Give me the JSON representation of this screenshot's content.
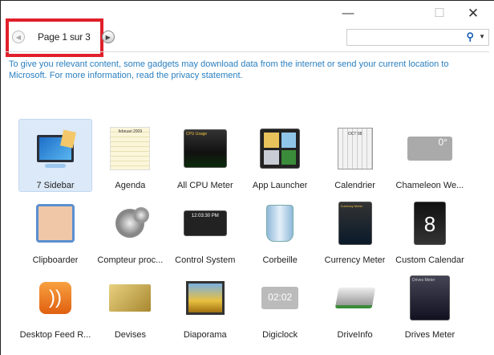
{
  "window": {
    "minimize": "—",
    "maximize": "☐",
    "close": "✕"
  },
  "pager": {
    "label": "Page 1 sur 3",
    "prev": "◀",
    "next": "▶"
  },
  "search": {
    "value": "",
    "placeholder": "",
    "search_icon": "⚲",
    "dropdown": "▼"
  },
  "notice": "To give you relevant content, some gadgets may download data from the internet or send your current location to Microsoft. For more information, read the privacy statement.",
  "gadgets": [
    {
      "label": "7 Sidebar",
      "icon": "monitor-icon",
      "selected": true
    },
    {
      "label": "Agenda",
      "icon": "agenda-calendar-icon",
      "glyph": "februari 2009"
    },
    {
      "label": "All CPU Meter",
      "icon": "cpu-meter-icon",
      "glyph": "CPU Usage"
    },
    {
      "label": "App Launcher",
      "icon": "app-launcher-icon"
    },
    {
      "label": "Calendrier",
      "icon": "calendar-icon",
      "glyph": "OCT 08"
    },
    {
      "label": "Chameleon We...",
      "icon": "weather-icon",
      "glyph": "0°"
    },
    {
      "label": "Clipboarder",
      "icon": "clipboarder-icon"
    },
    {
      "label": "Compteur proc...",
      "icon": "gauge-icon"
    },
    {
      "label": "Control System",
      "icon": "control-system-icon",
      "glyph": "12:03:30 PM"
    },
    {
      "label": "Corbeille",
      "icon": "recycle-bin-icon"
    },
    {
      "label": "Currency Meter",
      "icon": "currency-meter-icon",
      "glyph": "Currency Meter"
    },
    {
      "label": "Custom Calendar",
      "icon": "custom-calendar-icon",
      "glyph": "8"
    },
    {
      "label": "Desktop Feed R...",
      "icon": "rss-feed-icon"
    },
    {
      "label": "Devises",
      "icon": "currency-card-icon"
    },
    {
      "label": "Diaporama",
      "icon": "slideshow-icon"
    },
    {
      "label": "Digiclock",
      "icon": "digital-clock-icon",
      "glyph": "02:02"
    },
    {
      "label": "DriveInfo",
      "icon": "drive-icon"
    },
    {
      "label": "Drives Meter",
      "icon": "drives-meter-icon",
      "glyph": "Drives Meter"
    }
  ]
}
